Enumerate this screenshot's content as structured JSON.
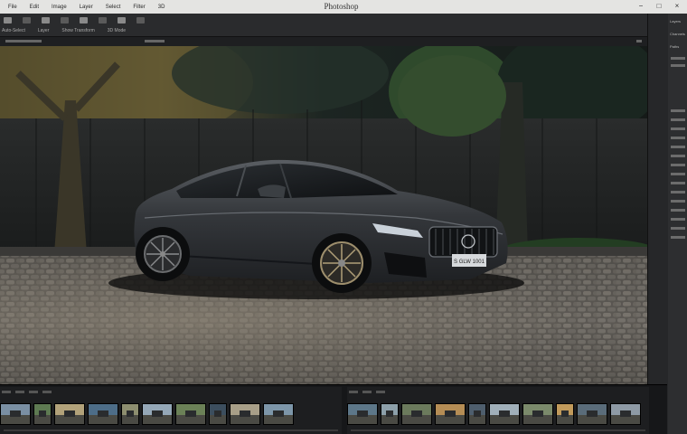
{
  "app": {
    "title": "Photoshop",
    "menu": [
      "File",
      "Edit",
      "Image",
      "Layer",
      "Select",
      "Filter",
      "3D"
    ],
    "window_controls": [
      "−",
      "□",
      "×"
    ]
  },
  "toolbar": {
    "labels": [
      "Auto-Select",
      "Layer",
      "Show Transform",
      "3D Mode"
    ]
  },
  "panel": {
    "labels": [
      "Layers",
      "Channels",
      "Paths"
    ]
  },
  "document": {
    "plate_text": "S GLW 1001"
  },
  "filmstrip": {
    "left_thumbs": [
      "#7a8fa3",
      "#5e7a52",
      "#b2a27a",
      "#4d6d88",
      "#8d8e6f",
      "#94a7b7",
      "#6b8157",
      "#3c4e5e",
      "#a89f88",
      "#7d96a9"
    ],
    "right_thumbs": [
      "#5d7789",
      "#8da0aa",
      "#6b7a5c",
      "#b58d55",
      "#4e5e6d",
      "#a0afb9",
      "#7b8a6b",
      "#c19a5b",
      "#5a6c7a",
      "#8e9aa5"
    ]
  },
  "colors": {
    "menubar": "#e4e4e2",
    "workspace": "#1a1b1d",
    "car_body": "#2e3033",
    "cobblestone": "#6d6b67"
  }
}
